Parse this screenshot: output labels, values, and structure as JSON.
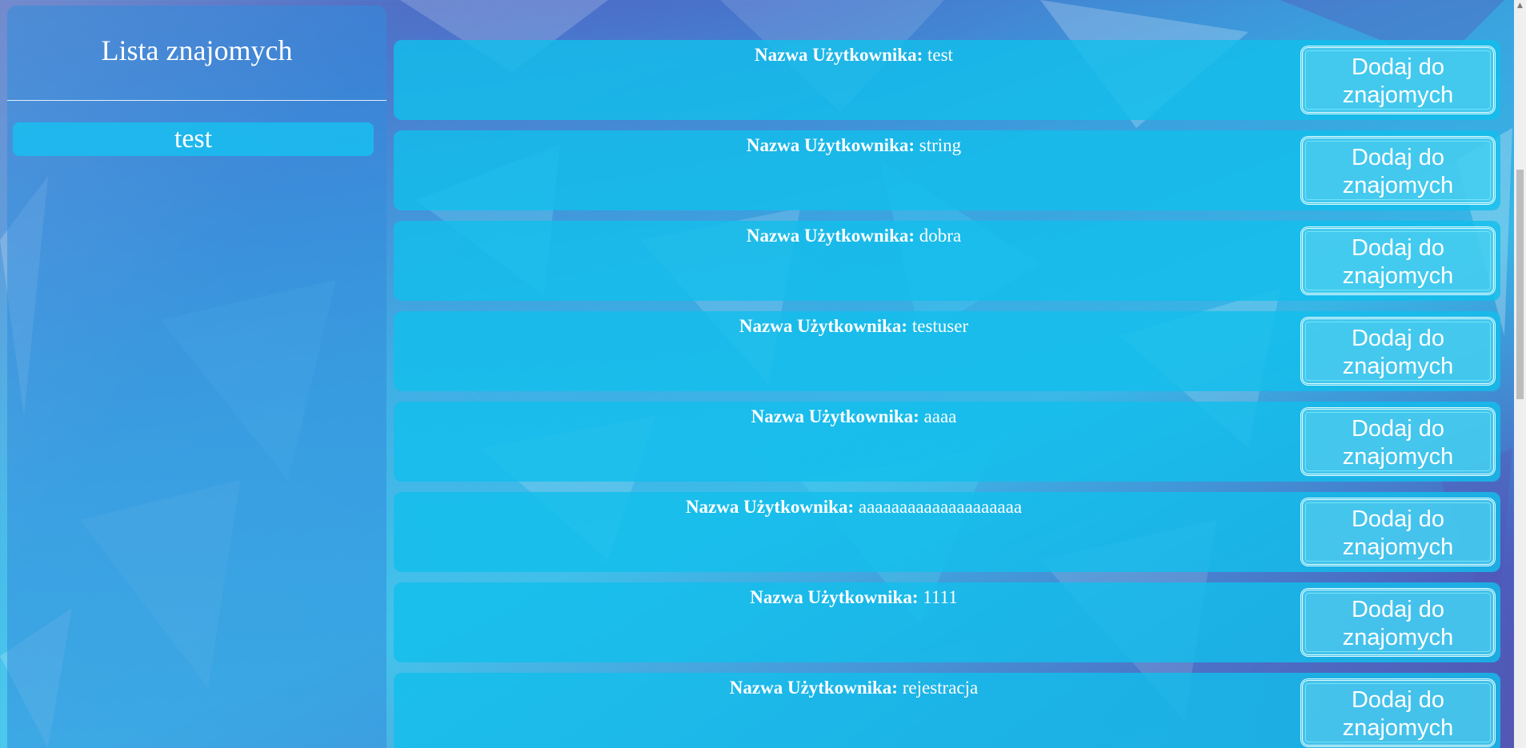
{
  "sidebar": {
    "title": "Lista znajomych",
    "friends": [
      "test"
    ]
  },
  "users": {
    "field_label": "Nazwa Użytkownika:",
    "add_button_label": "Dodaj do znajomych",
    "items": [
      {
        "username": "test"
      },
      {
        "username": "string"
      },
      {
        "username": "dobra"
      },
      {
        "username": "testuser"
      },
      {
        "username": "aaaa"
      },
      {
        "username": "aaaaaaaaaaaaaaaaaaaa"
      },
      {
        "username": "1111"
      },
      {
        "username": "rejestracja"
      }
    ]
  },
  "colors": {
    "card": "#12beec",
    "sidebar": "#328cdc",
    "text": "#ffffff"
  }
}
